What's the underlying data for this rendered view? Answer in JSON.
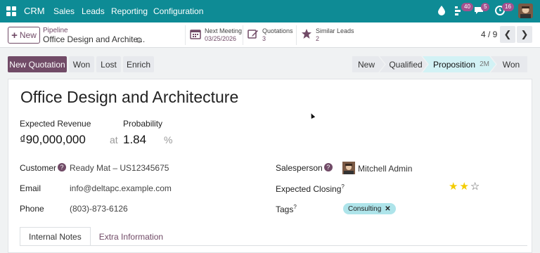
{
  "navbar": {
    "app_name": "CRM",
    "menu": [
      "Sales",
      "Leads",
      "Reporting",
      "Configuration"
    ],
    "activity_count": "40",
    "messages_count": "5",
    "clock_count": "16"
  },
  "control_panel": {
    "new_label": "New",
    "breadcrumb_parent": "Pipeline",
    "breadcrumb_current": "Office Design and Archite...",
    "smart_buttons": [
      {
        "label": "Next Meeting",
        "value": "03/25/2026",
        "icon": "calendar-icon"
      },
      {
        "label": "Quotations",
        "value": "3",
        "icon": "pencil-square-icon"
      },
      {
        "label": "Similar Leads",
        "value": "2",
        "icon": "star-icon"
      }
    ],
    "pager": "4 / 9"
  },
  "actions": [
    "New Quotation",
    "Won",
    "Lost",
    "Enrich"
  ],
  "stages": [
    {
      "label": "New",
      "duration": ""
    },
    {
      "label": "Qualified",
      "duration": ""
    },
    {
      "label": "Proposition",
      "duration": "2M"
    },
    {
      "label": "Won",
      "duration": ""
    }
  ],
  "form": {
    "title": "Office Design and Architecture",
    "expected_revenue_label": "Expected Revenue",
    "expected_revenue": "₫90,000,000",
    "at": "at",
    "probability_label": "Probability",
    "probability": "1.84",
    "percent": "%",
    "customer_label": "Customer",
    "customer": "Ready Mat – US12345675",
    "email_label": "Email",
    "email": "info@deltapc.example.com",
    "phone_label": "Phone",
    "phone": "(803)-873-6126",
    "salesperson_label": "Salesperson",
    "salesperson": "Mitchell Admin",
    "expected_closing_label": "Expected Closing",
    "tags_label": "Tags",
    "tag": "Consulting",
    "priority_stars": 2,
    "priority_max": 3,
    "help_mark": "?"
  },
  "tabs": [
    "Internal Notes",
    "Extra Information"
  ],
  "colors": {
    "navbar": "#0e8b95",
    "primary": "#714b67",
    "active_stage": "#d2f2f5",
    "star_on": "#f3cc00",
    "tag": "#aee4ea"
  }
}
